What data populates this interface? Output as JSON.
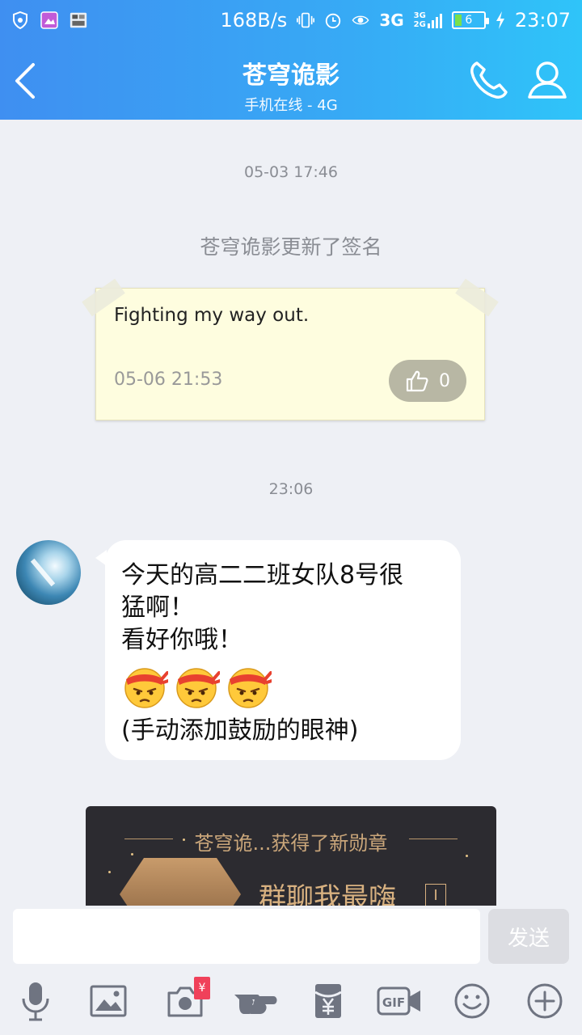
{
  "status_bar": {
    "net_speed": "168B/s",
    "net_type": "3G",
    "net_type2": "3G",
    "net_type3": "2G",
    "battery": "6",
    "time": "23:07"
  },
  "header": {
    "title": "苍穹诡影",
    "subtitle": "手机在线 - 4G"
  },
  "chat": {
    "timestamp_1": "05-03 17:46",
    "system_notice": "苍穹诡影更新了签名",
    "signature_card": {
      "text": "Fighting my way out.",
      "time": "05-06 21:53",
      "likes": "0"
    },
    "timestamp_2": "23:06",
    "message": {
      "line1": "今天的高二二班女队8号很",
      "line2": "猛啊！",
      "line3": "看好你哦！",
      "line4": "(手动添加鼓励的眼神)"
    },
    "badge_card": {
      "title": "苍穹诡...获得了新勋章",
      "badge_name": "群聊我最嗨",
      "badge_level": "I"
    }
  },
  "input": {
    "placeholder": "",
    "send_label": "发送"
  },
  "toolbar": {
    "red_packet_symbol": "¥",
    "gif_label": "GIF"
  },
  "colors": {
    "header_gradient_start": "#3f8ff1",
    "header_gradient_end": "#2fc4f9",
    "background": "#eef0f5",
    "note_bg": "#fefddf",
    "badge_gold": "#caa67a"
  }
}
